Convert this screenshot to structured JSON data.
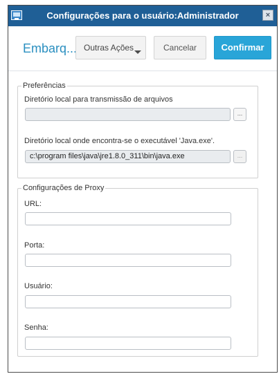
{
  "window": {
    "title": "Configurações para o usuário:Administrador",
    "close_label": "×"
  },
  "header": {
    "page_name": "Embarq...",
    "more_actions_label": "Outras Ações",
    "cancel_label": "Cancelar",
    "confirm_label": "Confirmar"
  },
  "preferences": {
    "legend": "Preferências",
    "transfer_dir_label": "Diretório local para transmissão de arquivos",
    "transfer_dir_value": "",
    "transfer_browse_label": "...",
    "java_dir_label": "Diretório local onde encontra-se o executável 'Java.exe'.",
    "java_dir_value": "c:\\program files\\java\\jre1.8.0_311\\bin\\java.exe",
    "java_browse_label": "..."
  },
  "proxy": {
    "legend": "Configurações de Proxy",
    "url_label": "URL:",
    "url_value": "",
    "port_label": "Porta:",
    "port_value": "",
    "user_label": "Usuário:",
    "user_value": "",
    "password_label": "Senha:",
    "password_value": ""
  }
}
